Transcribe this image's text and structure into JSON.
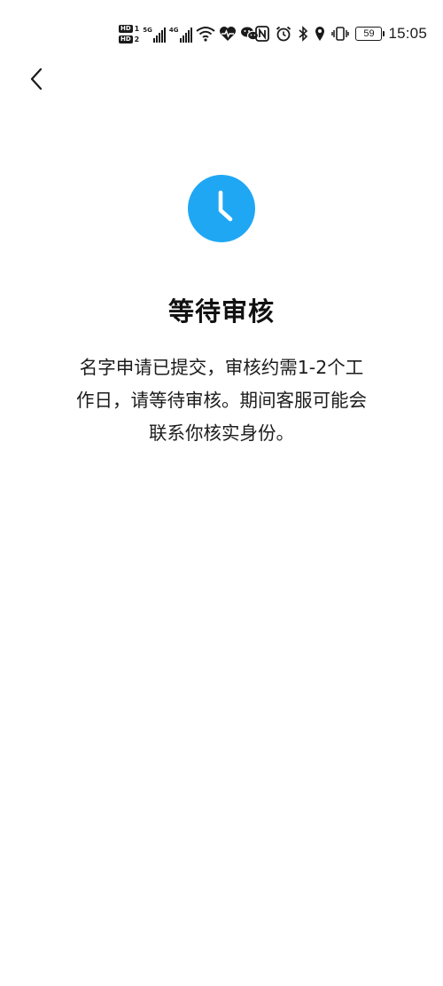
{
  "status_bar": {
    "sim1_label": "HD",
    "sim1_index": "1",
    "sim2_label": "HD",
    "sim2_index": "2",
    "network1": "5G",
    "network2": "4G",
    "battery_level": "59",
    "time": "15:05",
    "icons": [
      "wifi-icon",
      "heart-health-icon",
      "wechat-icon",
      "nfc-icon",
      "alarm-icon",
      "bluetooth-icon",
      "location-icon",
      "vibrate-icon"
    ]
  },
  "nav": {
    "back_icon": "chevron-left-icon"
  },
  "status_icon": {
    "icon": "clock-icon",
    "color": "#1fa7f4"
  },
  "main": {
    "title": "等待审核",
    "description_lines": [
      "名字申请已提交，审核约需1-2个工",
      "作日，请等待审核。期间客服可能会",
      "联系你核实身份。"
    ]
  }
}
